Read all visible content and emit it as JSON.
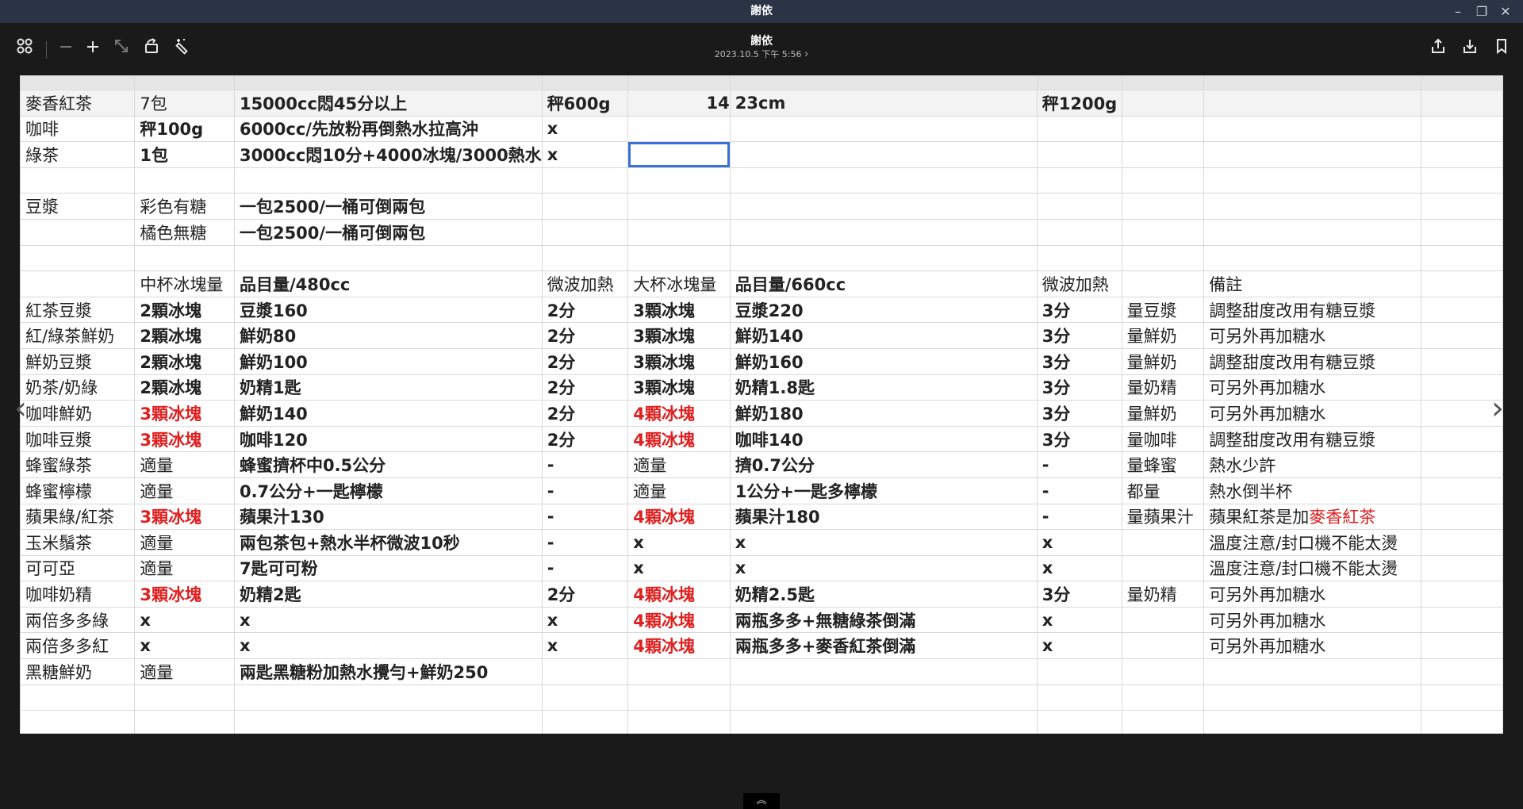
{
  "window": {
    "title": "謝依"
  },
  "toolbar": {
    "doc_title": "謝依",
    "doc_date": "2023.10.5 下午 5:56",
    "chevron": "›"
  },
  "sheet": {
    "rows": [
      [
        {
          "t": "麥香紅茶"
        },
        {
          "t": "7包"
        },
        {
          "t": "15000cc悶45分以上",
          "b": 1
        },
        {
          "t": "秤600g",
          "b": 1
        },
        {
          "t": "14",
          "b": 1,
          "r": 1
        },
        {
          "t": "23cm",
          "b": 1
        },
        {
          "t": "秤1200g",
          "b": 1
        },
        {
          "t": ""
        },
        {
          "t": ""
        },
        {
          "t": ""
        }
      ],
      [
        {
          "t": "咖啡"
        },
        {
          "t": "秤100g",
          "b": 1
        },
        {
          "t": "6000cc/先放粉再倒熱水拉高沖",
          "b": 1
        },
        {
          "t": "x",
          "b": 1
        },
        {
          "t": ""
        },
        {
          "t": ""
        },
        {
          "t": ""
        },
        {
          "t": ""
        },
        {
          "t": ""
        },
        {
          "t": ""
        }
      ],
      [
        {
          "t": "綠茶"
        },
        {
          "t": "1包",
          "b": 1
        },
        {
          "t": "3000cc悶10分+4000冰塊/3000熱水",
          "b": 1
        },
        {
          "t": "x",
          "b": 1
        },
        {
          "t": "",
          "sel": 1
        },
        {
          "t": ""
        },
        {
          "t": ""
        },
        {
          "t": ""
        },
        {
          "t": ""
        },
        {
          "t": ""
        }
      ],
      [
        {
          "t": ""
        },
        {
          "t": ""
        },
        {
          "t": ""
        },
        {
          "t": ""
        },
        {
          "t": ""
        },
        {
          "t": ""
        },
        {
          "t": ""
        },
        {
          "t": ""
        },
        {
          "t": ""
        },
        {
          "t": ""
        }
      ],
      [
        {
          "t": "豆漿"
        },
        {
          "t": "彩色有糖"
        },
        {
          "t": "一包2500/一桶可倒兩包",
          "b": 1
        },
        {
          "t": ""
        },
        {
          "t": ""
        },
        {
          "t": ""
        },
        {
          "t": ""
        },
        {
          "t": ""
        },
        {
          "t": ""
        },
        {
          "t": ""
        }
      ],
      [
        {
          "t": ""
        },
        {
          "t": "橘色無糖"
        },
        {
          "t": "一包2500/一桶可倒兩包",
          "b": 1
        },
        {
          "t": ""
        },
        {
          "t": ""
        },
        {
          "t": ""
        },
        {
          "t": ""
        },
        {
          "t": ""
        },
        {
          "t": ""
        },
        {
          "t": ""
        }
      ],
      [
        {
          "t": ""
        },
        {
          "t": ""
        },
        {
          "t": ""
        },
        {
          "t": ""
        },
        {
          "t": ""
        },
        {
          "t": ""
        },
        {
          "t": ""
        },
        {
          "t": ""
        },
        {
          "t": ""
        },
        {
          "t": ""
        }
      ],
      [
        {
          "t": ""
        },
        {
          "t": "中杯冰塊量"
        },
        {
          "t": "品目量/480cc",
          "b": 1
        },
        {
          "t": "微波加熱"
        },
        {
          "t": "大杯冰塊量"
        },
        {
          "t": "品目量/660cc",
          "b": 1
        },
        {
          "t": "微波加熱"
        },
        {
          "t": ""
        },
        {
          "t": "備註"
        },
        {
          "t": ""
        }
      ],
      [
        {
          "t": "紅茶豆漿"
        },
        {
          "t": "2顆冰塊",
          "b": 1
        },
        {
          "t": "豆漿160",
          "b": 1
        },
        {
          "t": "2分",
          "b": 1
        },
        {
          "t": "3顆冰塊",
          "b": 1
        },
        {
          "t": "豆漿220",
          "b": 1
        },
        {
          "t": "3分",
          "b": 1
        },
        {
          "t": "量豆漿"
        },
        {
          "t": "調整甜度改用有糖豆漿"
        },
        {
          "t": ""
        }
      ],
      [
        {
          "t": "紅/綠茶鮮奶"
        },
        {
          "t": "2顆冰塊",
          "b": 1
        },
        {
          "t": "鮮奶80",
          "b": 1
        },
        {
          "t": "2分",
          "b": 1
        },
        {
          "t": "3顆冰塊",
          "b": 1
        },
        {
          "t": "鮮奶140",
          "b": 1
        },
        {
          "t": "3分",
          "b": 1
        },
        {
          "t": "量鮮奶"
        },
        {
          "t": "可另外再加糖水"
        },
        {
          "t": ""
        }
      ],
      [
        {
          "t": "鮮奶豆漿"
        },
        {
          "t": "2顆冰塊",
          "b": 1
        },
        {
          "t": "鮮奶100",
          "b": 1
        },
        {
          "t": "2分",
          "b": 1
        },
        {
          "t": "3顆冰塊",
          "b": 1
        },
        {
          "t": "鮮奶160",
          "b": 1
        },
        {
          "t": "3分",
          "b": 1
        },
        {
          "t": "量鮮奶"
        },
        {
          "t": "調整甜度改用有糖豆漿"
        },
        {
          "t": ""
        }
      ],
      [
        {
          "t": "奶茶/奶綠"
        },
        {
          "t": "2顆冰塊",
          "b": 1
        },
        {
          "t": "奶精1匙",
          "b": 1
        },
        {
          "t": "2分",
          "b": 1
        },
        {
          "t": "3顆冰塊",
          "b": 1
        },
        {
          "t": "奶精1.8匙",
          "b": 1
        },
        {
          "t": "3分",
          "b": 1
        },
        {
          "t": "量奶精"
        },
        {
          "t": "可另外再加糖水"
        },
        {
          "t": ""
        }
      ],
      [
        {
          "t": "咖啡鮮奶"
        },
        {
          "t": "3顆冰塊",
          "b": 1,
          "red": 1
        },
        {
          "t": "鮮奶140",
          "b": 1
        },
        {
          "t": "2分",
          "b": 1
        },
        {
          "t": "4顆冰塊",
          "b": 1,
          "red": 1
        },
        {
          "t": "鮮奶180",
          "b": 1
        },
        {
          "t": "3分",
          "b": 1
        },
        {
          "t": "量鮮奶"
        },
        {
          "t": "可另外再加糖水"
        },
        {
          "t": ""
        }
      ],
      [
        {
          "t": "咖啡豆漿"
        },
        {
          "t": "3顆冰塊",
          "b": 1,
          "red": 1
        },
        {
          "t": "咖啡120",
          "b": 1
        },
        {
          "t": "2分",
          "b": 1
        },
        {
          "t": "4顆冰塊",
          "b": 1,
          "red": 1
        },
        {
          "t": "咖啡140",
          "b": 1
        },
        {
          "t": "3分",
          "b": 1
        },
        {
          "t": "量咖啡"
        },
        {
          "t": "調整甜度改用有糖豆漿"
        },
        {
          "t": ""
        }
      ],
      [
        {
          "t": "蜂蜜綠茶"
        },
        {
          "t": "適量"
        },
        {
          "t": "蜂蜜擠杯中0.5公分",
          "b": 1
        },
        {
          "t": "-",
          "b": 1
        },
        {
          "t": "適量"
        },
        {
          "t": "擠0.7公分",
          "b": 1
        },
        {
          "t": "-",
          "b": 1
        },
        {
          "t": "量蜂蜜"
        },
        {
          "t": "熱水少許"
        },
        {
          "t": ""
        }
      ],
      [
        {
          "t": "蜂蜜檸檬"
        },
        {
          "t": "適量"
        },
        {
          "t": "0.7公分+一匙檸檬",
          "b": 1
        },
        {
          "t": "-",
          "b": 1
        },
        {
          "t": "適量"
        },
        {
          "t": "1公分+一匙多檸檬",
          "b": 1
        },
        {
          "t": "-",
          "b": 1
        },
        {
          "t": "都量"
        },
        {
          "t": "熱水倒半杯"
        },
        {
          "t": ""
        }
      ],
      [
        {
          "t": "蘋果綠/紅茶"
        },
        {
          "t": "3顆冰塊",
          "b": 1,
          "red": 1
        },
        {
          "t": "蘋果汁130",
          "b": 1
        },
        {
          "t": "-",
          "b": 1
        },
        {
          "t": "4顆冰塊",
          "b": 1,
          "red": 1
        },
        {
          "t": "蘋果汁180",
          "b": 1
        },
        {
          "t": "-",
          "b": 1
        },
        {
          "t": "量蘋果汁"
        },
        {
          "t": "蘋果紅茶是加",
          "tr": "麥香紅茶"
        },
        {
          "t": ""
        }
      ],
      [
        {
          "t": "玉米鬚茶"
        },
        {
          "t": "適量"
        },
        {
          "t": "兩包茶包+熱水半杯微波10秒",
          "b": 1
        },
        {
          "t": "-",
          "b": 1
        },
        {
          "t": "x",
          "b": 1
        },
        {
          "t": "x",
          "b": 1
        },
        {
          "t": "x",
          "b": 1
        },
        {
          "t": ""
        },
        {
          "t": "溫度注意/封口機不能太燙"
        },
        {
          "t": ""
        }
      ],
      [
        {
          "t": "可可亞"
        },
        {
          "t": "適量"
        },
        {
          "t": "7匙可可粉",
          "b": 1
        },
        {
          "t": "-",
          "b": 1
        },
        {
          "t": "x",
          "b": 1
        },
        {
          "t": "x",
          "b": 1
        },
        {
          "t": "x",
          "b": 1
        },
        {
          "t": ""
        },
        {
          "t": "溫度注意/封口機不能太燙"
        },
        {
          "t": ""
        }
      ],
      [
        {
          "t": "咖啡奶精"
        },
        {
          "t": "3顆冰塊",
          "b": 1,
          "red": 1
        },
        {
          "t": "奶精2匙",
          "b": 1
        },
        {
          "t": "2分",
          "b": 1
        },
        {
          "t": "4顆冰塊",
          "b": 1,
          "red": 1
        },
        {
          "t": "奶精2.5匙",
          "b": 1
        },
        {
          "t": "3分",
          "b": 1
        },
        {
          "t": "量奶精"
        },
        {
          "t": "可另外再加糖水"
        },
        {
          "t": ""
        }
      ],
      [
        {
          "t": "兩倍多多綠"
        },
        {
          "t": "x",
          "b": 1
        },
        {
          "t": "x",
          "b": 1
        },
        {
          "t": "x",
          "b": 1
        },
        {
          "t": "4顆冰塊",
          "b": 1,
          "red": 1
        },
        {
          "t": "兩瓶多多+無糖綠茶倒滿",
          "b": 1
        },
        {
          "t": "x",
          "b": 1
        },
        {
          "t": ""
        },
        {
          "t": "可另外再加糖水"
        },
        {
          "t": ""
        }
      ],
      [
        {
          "t": "兩倍多多紅"
        },
        {
          "t": "x",
          "b": 1
        },
        {
          "t": "x",
          "b": 1
        },
        {
          "t": "x",
          "b": 1
        },
        {
          "t": "4顆冰塊",
          "b": 1,
          "red": 1
        },
        {
          "t": "兩瓶多多+麥香紅茶倒滿",
          "b": 1
        },
        {
          "t": "x",
          "b": 1
        },
        {
          "t": ""
        },
        {
          "t": "可另外再加糖水"
        },
        {
          "t": ""
        }
      ],
      [
        {
          "t": "黑糖鮮奶"
        },
        {
          "t": "適量"
        },
        {
          "t": "兩匙黑糖粉加熱水攪勻+鮮奶250",
          "b": 1
        },
        {
          "t": ""
        },
        {
          "t": ""
        },
        {
          "t": ""
        },
        {
          "t": ""
        },
        {
          "t": ""
        },
        {
          "t": ""
        },
        {
          "t": ""
        }
      ],
      [
        {
          "t": ""
        },
        {
          "t": ""
        },
        {
          "t": ""
        },
        {
          "t": ""
        },
        {
          "t": ""
        },
        {
          "t": ""
        },
        {
          "t": ""
        },
        {
          "t": ""
        },
        {
          "t": ""
        },
        {
          "t": ""
        }
      ],
      [
        {
          "t": ""
        },
        {
          "t": ""
        },
        {
          "t": ""
        },
        {
          "t": ""
        },
        {
          "t": ""
        },
        {
          "t": ""
        },
        {
          "t": ""
        },
        {
          "t": ""
        },
        {
          "t": ""
        },
        {
          "t": ""
        }
      ]
    ]
  },
  "colors": {
    "titlebar": "#2b3445",
    "selection": "#3a6fd8",
    "red_text": "#e02020"
  }
}
